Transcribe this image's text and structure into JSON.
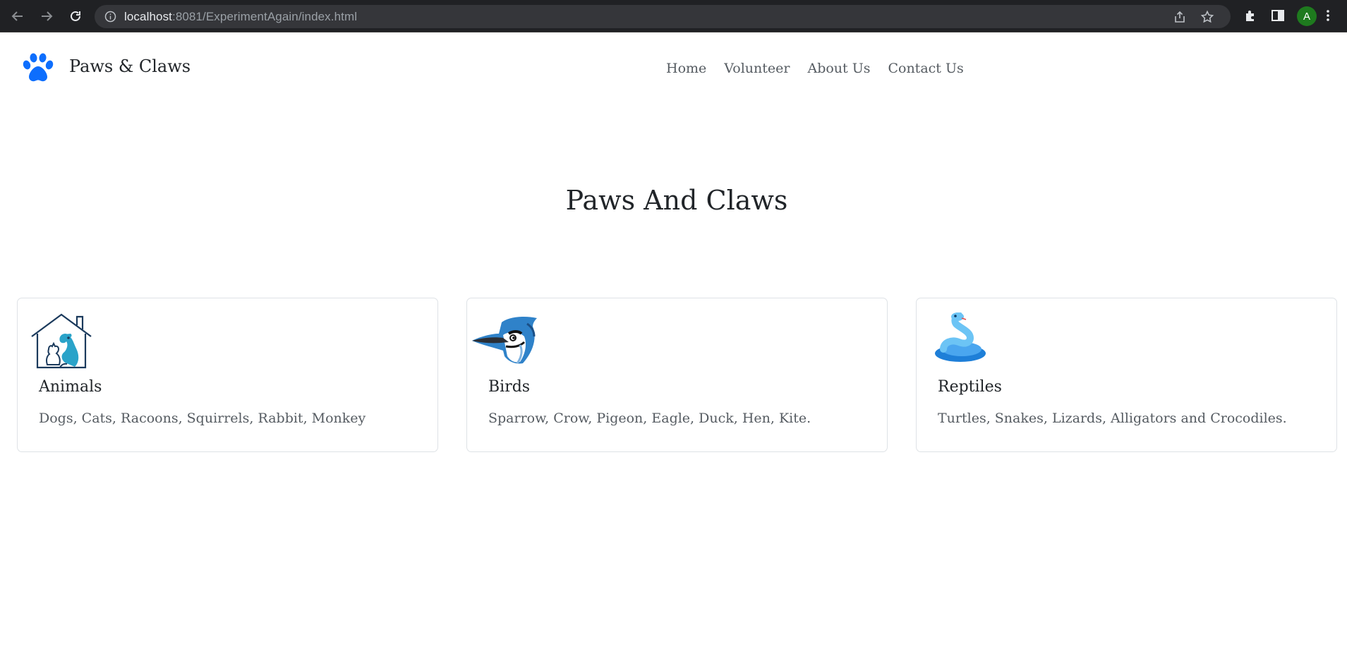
{
  "browser": {
    "url_host": "localhost",
    "url_path": ":8081/ExperimentAgain/index.html",
    "avatar_letter": "A"
  },
  "navbar": {
    "brand": "Paws & Claws",
    "links": [
      "Home",
      "Volunteer",
      "About Us",
      "Contact Us"
    ]
  },
  "hero": {
    "title": "Paws And Claws"
  },
  "cards": [
    {
      "title": "Animals",
      "text": "Dogs, Cats, Racoons, Squirrels, Rabbit, Monkey",
      "icon": "pet-house-icon"
    },
    {
      "title": "Birds",
      "text": "Sparrow, Crow, Pigeon, Eagle, Duck, Hen, Kite.",
      "icon": "blue-jay-icon"
    },
    {
      "title": "Reptiles",
      "text": "Turtles, Snakes, Lizards, Alligators and Crocodiles.",
      "icon": "snake-icon"
    }
  ],
  "colors": {
    "brand_accent": "#0d6efd",
    "chrome_bg": "#202124",
    "card_border": "#dee2e6"
  }
}
